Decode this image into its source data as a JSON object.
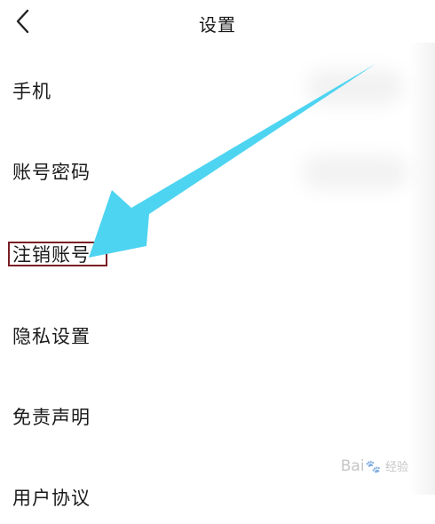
{
  "header": {
    "title": "设置",
    "back_icon": "chevron-left-icon"
  },
  "menu": [
    {
      "label": "手机"
    },
    {
      "label": "账号密码"
    },
    {
      "label": "注销账号"
    },
    {
      "label": "隐私设置"
    },
    {
      "label": "免责声明"
    },
    {
      "label": "用户协议"
    }
  ],
  "annotation": {
    "arrow_color": "#4dd4f0",
    "box_color": "#7a1f24"
  },
  "watermark": {
    "brand_left": "Bai",
    "brand_right": "经验"
  }
}
